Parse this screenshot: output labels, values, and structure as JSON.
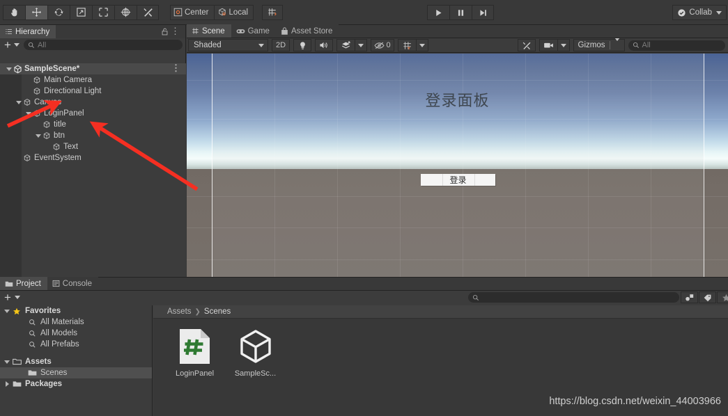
{
  "toolbar": {
    "tools": [
      {
        "name": "hand-tool",
        "glyph": "✋",
        "active": false
      },
      {
        "name": "move-tool",
        "glyph": "move",
        "active": true
      },
      {
        "name": "rotate-tool",
        "glyph": "rotate",
        "active": false
      },
      {
        "name": "scale-tool",
        "glyph": "scale",
        "active": false
      },
      {
        "name": "rect-tool",
        "glyph": "rect",
        "active": false
      },
      {
        "name": "transform-tool",
        "glyph": "transform",
        "active": false
      },
      {
        "name": "custom-tool",
        "glyph": "wrench",
        "active": false
      }
    ],
    "pivot_label": "Center",
    "space_label": "Local",
    "snap_label": "",
    "play_label": "▶",
    "pause_label": "❙❙",
    "step_label": "▶❙",
    "collab_label": "Collab"
  },
  "hierarchy": {
    "tab_label": "Hierarchy",
    "search_placeholder": "All",
    "rows": [
      {
        "label": "SampleScene*",
        "depth": 0,
        "icon": "unity-scene-icon",
        "expanded": true,
        "is_scene": true
      },
      {
        "label": "Main Camera",
        "depth": 2,
        "icon": "gameobject-icon",
        "expanded": null
      },
      {
        "label": "Directional Light",
        "depth": 2,
        "icon": "gameobject-icon",
        "expanded": null
      },
      {
        "label": "Canvas",
        "depth": 1,
        "icon": "gameobject-icon",
        "expanded": true
      },
      {
        "label": "LoginPanel",
        "depth": 2,
        "icon": "gameobject-icon",
        "expanded": true
      },
      {
        "label": "title",
        "depth": 3,
        "icon": "gameobject-icon",
        "expanded": null
      },
      {
        "label": "btn",
        "depth": 3,
        "icon": "gameobject-icon",
        "expanded": true
      },
      {
        "label": "Text",
        "depth": 4,
        "icon": "gameobject-icon",
        "expanded": null
      },
      {
        "label": "EventSystem",
        "depth": 1,
        "icon": "gameobject-icon",
        "expanded": null
      }
    ]
  },
  "sceneview": {
    "tabs": [
      {
        "label": "Scene",
        "icon": "scene-grid-icon",
        "active": true
      },
      {
        "label": "Game",
        "icon": "gamepad-icon",
        "active": false
      },
      {
        "label": "Asset Store",
        "icon": "store-bag-icon",
        "active": false
      }
    ],
    "draw_mode": "Shaded",
    "mode_2d": "2D",
    "audio_count": "0",
    "gizmos_label": "Gizmos",
    "search_placeholder": "All",
    "canvas_title": "登录面板",
    "login_button_label": "登录"
  },
  "project": {
    "tabs": [
      {
        "label": "Project",
        "icon": "folder-icon",
        "active": true
      },
      {
        "label": "Console",
        "icon": "console-icon",
        "active": false
      }
    ],
    "search_placeholder": "",
    "tree": [
      {
        "label": "Favorites",
        "depth": 0,
        "icon": "star-icon",
        "expanded": true,
        "bold": true,
        "selected": false
      },
      {
        "label": "All Materials",
        "depth": 1,
        "icon": "search-icon",
        "expanded": null,
        "bold": false,
        "selected": false
      },
      {
        "label": "All Models",
        "depth": 1,
        "icon": "search-icon",
        "expanded": null,
        "bold": false,
        "selected": false
      },
      {
        "label": "All Prefabs",
        "depth": 1,
        "icon": "search-icon",
        "expanded": null,
        "bold": false,
        "selected": false
      },
      {
        "label": "",
        "depth": 0,
        "icon": "spacer",
        "expanded": null,
        "bold": false,
        "selected": false
      },
      {
        "label": "Assets",
        "depth": 0,
        "icon": "folder-open-icon",
        "expanded": true,
        "bold": true,
        "selected": false
      },
      {
        "label": "Scenes",
        "depth": 1,
        "icon": "folder-icon",
        "expanded": null,
        "bold": false,
        "selected": true
      },
      {
        "label": "Packages",
        "depth": 0,
        "icon": "folder-icon",
        "expanded": false,
        "bold": true,
        "selected": false
      }
    ],
    "breadcrumb": [
      "Assets",
      "Scenes"
    ],
    "assets": [
      {
        "label": "LoginPanel",
        "icon": "csharp-script-icon"
      },
      {
        "label": "SampleSc...",
        "icon": "unity-scene-icon"
      }
    ]
  },
  "watermark": "https://blog.csdn.net/weixin_44003966",
  "colors": {
    "accent_orange": "#e0703c",
    "favorites_star": "#f5c518",
    "csharp_green": "#2f7a32",
    "arrow_red": "#f52f22"
  }
}
